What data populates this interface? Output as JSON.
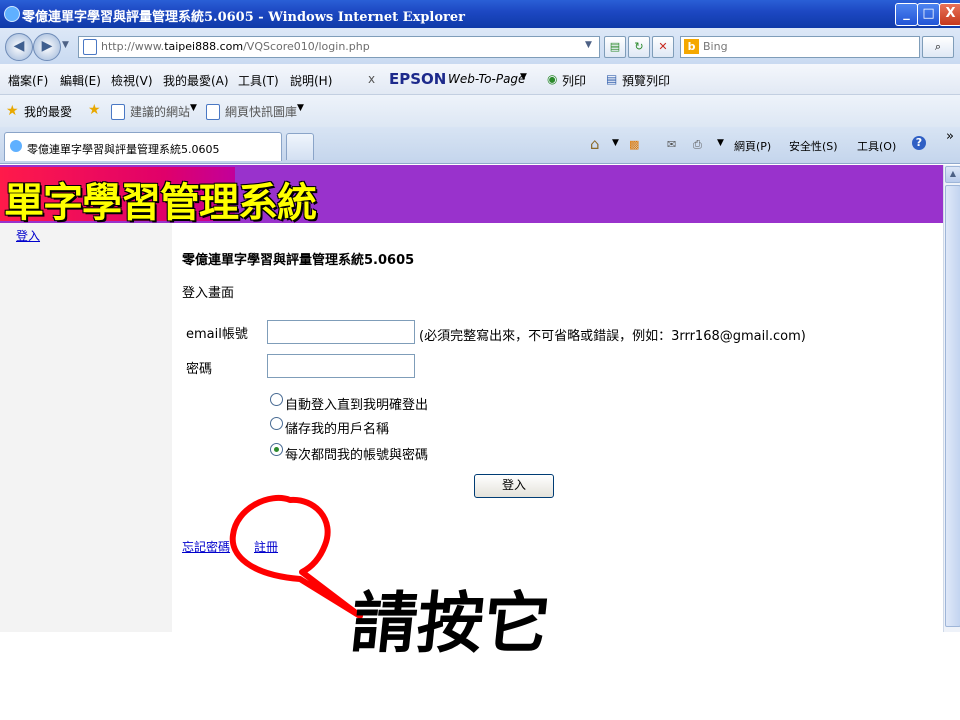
{
  "window": {
    "title": "零億連單字學習與評量管理系統5.0605 - Windows Internet Explorer",
    "minimize": "_",
    "maximize": "□",
    "close": "X"
  },
  "address_bar": {
    "url_prefix": "http://www.",
    "url_domain": "taipei888.com",
    "url_path": "/VQScore010/login.php",
    "search_placeholder": "Bing",
    "search_logo": "b"
  },
  "menu": {
    "items": [
      "檔案(F)",
      "編輯(E)",
      "檢視(V)",
      "我的最愛(A)",
      "工具(T)",
      "說明(H)"
    ],
    "toolbar_close": "x",
    "epson": "EPSON",
    "web_to_page": "Web-To-Page",
    "print": "列印",
    "preview": "預覽列印"
  },
  "favorites": {
    "favorites_label": "我的最愛",
    "suggested_sites": "建議的網站",
    "web_slice_gallery": "網頁快訊圖庫"
  },
  "tabs": {
    "active_title": "零億連單字學習與評量管理系統5.0605"
  },
  "command_bar": {
    "page": "網頁(P)",
    "safety": "安全性(S)",
    "tools": "工具(O)",
    "more": "»"
  },
  "page": {
    "banner_title": "單字學習管理系統",
    "sidebar_login": "登入",
    "system_title": "零億連單字學習與評量管理系統5.0605",
    "subtitle": "登入畫面",
    "email_label": "email帳號",
    "email_value": "",
    "email_hint": "(必須完整寫出來，不可省略或錯誤，例如：3rrr168@gmail.com)",
    "password_label": "密碼",
    "password_value": "",
    "radio_options": [
      "自動登入直到我明確登出",
      "儲存我的用戶名稱",
      "每次都問我的帳號與密碼"
    ],
    "selected_option": 2,
    "login_button": "登入",
    "forgot_password": "忘記密碼",
    "register": "註冊"
  },
  "annotation": {
    "text": "請按它",
    "color": "#ff0000"
  }
}
